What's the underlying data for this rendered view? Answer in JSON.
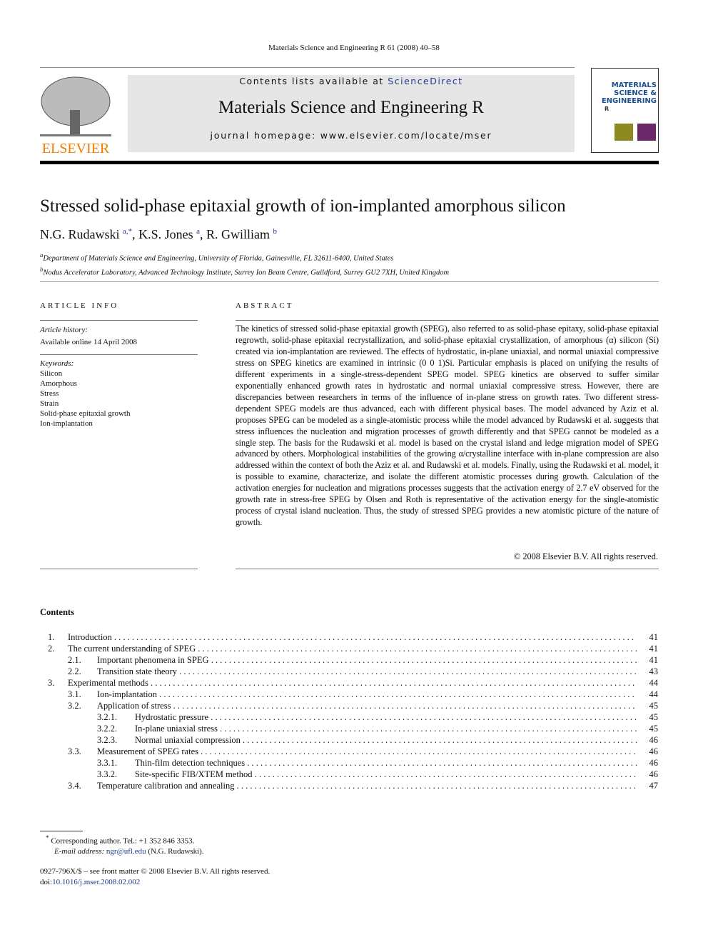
{
  "running_header": "Materials Science and Engineering R 61 (2008) 40–58",
  "journal": {
    "contents_prefix": "Contents lists available at ",
    "sciencedirect": "ScienceDirect",
    "name": "Materials Science and Engineering R",
    "homepage": "journal homepage: www.elsevier.com/locate/mser",
    "publisher": "ELSEVIER",
    "cover_title": [
      "MATERIALS",
      "SCIENCE &",
      "ENGINEERING"
    ],
    "cover_letter": "R"
  },
  "article": {
    "title": "Stressed solid-phase epitaxial growth of ion-implanted amorphous silicon",
    "authors": [
      {
        "name": "N.G. Rudawski",
        "sup": "a,*"
      },
      {
        "name": "K.S. Jones",
        "sup": "a"
      },
      {
        "name": "R. Gwilliam",
        "sup": "b"
      }
    ],
    "affiliations": [
      {
        "sup": "a",
        "text": "Department of Materials Science and Engineering, University of Florida, Gainesville, FL 32611-6400, United States"
      },
      {
        "sup": "b",
        "text": "Nodus Accelerator Laboratory, Advanced Technology Institute, Surrey Ion Beam Centre, Guildford, Surrey GU2 7XH, United Kingdom"
      }
    ]
  },
  "article_info": {
    "heading": "ARTICLE INFO",
    "history_label": "Article history:",
    "history": "Available online 14 April 2008",
    "keywords_label": "Keywords:",
    "keywords": [
      "Silicon",
      "Amorphous",
      "Stress",
      "Strain",
      "Solid-phase epitaxial growth",
      "Ion-implantation"
    ]
  },
  "abstract": {
    "heading": "ABSTRACT",
    "text": "The kinetics of stressed solid-phase epitaxial growth (SPEG), also referred to as solid-phase epitaxy, solid-phase epitaxial regrowth, solid-phase epitaxial recrystallization, and solid-phase epitaxial crystallization, of amorphous (α) silicon (Si) created via ion-implantation are reviewed. The effects of hydrostatic, in-plane uniaxial, and normal uniaxial compressive stress on SPEG kinetics are examined in intrinsic (0 0 1)Si. Particular emphasis is placed on unifying the results of different experiments in a single-stress-dependent SPEG model. SPEG kinetics are observed to suffer similar exponentially enhanced growth rates in hydrostatic and normal uniaxial compressive stress. However, there are discrepancies between researchers in terms of the influence of in-plane stress on growth rates. Two different stress-dependent SPEG models are thus advanced, each with different physical bases. The model advanced by Aziz et al. proposes SPEG can be modeled as a single-atomistic process while the model advanced by Rudawski et al. suggests that stress influences the nucleation and migration processes of growth differently and that SPEG cannot be modeled as a single step. The basis for the Rudawski et al. model is based on the crystal island and ledge migration model of SPEG advanced by others. Morphological instabilities of the growing α/crystalline interface with in-plane compression are also addressed within the context of both the Aziz et al. and Rudawski et al. models. Finally, using the Rudawski et al. model, it is possible to examine, characterize, and isolate the different atomistic processes during growth. Calculation of the activation energies for nucleation and migrations processes suggests that the activation energy of 2.7 eV observed for the growth rate in stress-free SPEG by Olsen and Roth is representative of the activation energy for the single-atomistic process of crystal island nucleation. Thus, the study of stressed SPEG provides a new atomistic picture of the nature of growth.",
    "copyright": "© 2008 Elsevier B.V. All rights reserved."
  },
  "contents": {
    "heading": "Contents",
    "items": [
      {
        "num": "1.",
        "title": "Introduction",
        "page": "41",
        "level": 0
      },
      {
        "num": "2.",
        "title": "The current understanding of SPEG",
        "page": "41",
        "level": 0
      },
      {
        "num": "2.1.",
        "title": "Important phenomena in SPEG",
        "page": "41",
        "level": 1
      },
      {
        "num": "2.2.",
        "title": "Transition state theory",
        "page": "43",
        "level": 1
      },
      {
        "num": "3.",
        "title": "Experimental methods",
        "page": "44",
        "level": 0
      },
      {
        "num": "3.1.",
        "title": "Ion-implantation",
        "page": "44",
        "level": 1
      },
      {
        "num": "3.2.",
        "title": "Application of stress",
        "page": "45",
        "level": 1
      },
      {
        "num": "3.2.1.",
        "title": "Hydrostatic pressure",
        "page": "45",
        "level": 2
      },
      {
        "num": "3.2.2.",
        "title": "In-plane uniaxial stress",
        "page": "45",
        "level": 2
      },
      {
        "num": "3.2.3.",
        "title": "Normal uniaxial compression",
        "page": "46",
        "level": 2
      },
      {
        "num": "3.3.",
        "title": "Measurement of SPEG rates",
        "page": "46",
        "level": 1
      },
      {
        "num": "3.3.1.",
        "title": "Thin-film detection techniques",
        "page": "46",
        "level": 2
      },
      {
        "num": "3.3.2.",
        "title": "Site-specific FIB/XTEM method",
        "page": "46",
        "level": 2
      },
      {
        "num": "3.4.",
        "title": "Temperature calibration and annealing",
        "page": "47",
        "level": 1
      }
    ]
  },
  "footnote": {
    "mark": "*",
    "text": "Corresponding author. Tel.: +1 352 846 3353.",
    "email_label": "E-mail address:",
    "email": "ngr@ufl.edu",
    "email_suffix": "(N.G. Rudawski)."
  },
  "footer": {
    "issn": "0927-796X/$ – see front matter © 2008 Elsevier B.V. All rights reserved.",
    "doi_prefix": "doi:",
    "doi": "10.1016/j.mser.2008.02.002"
  }
}
